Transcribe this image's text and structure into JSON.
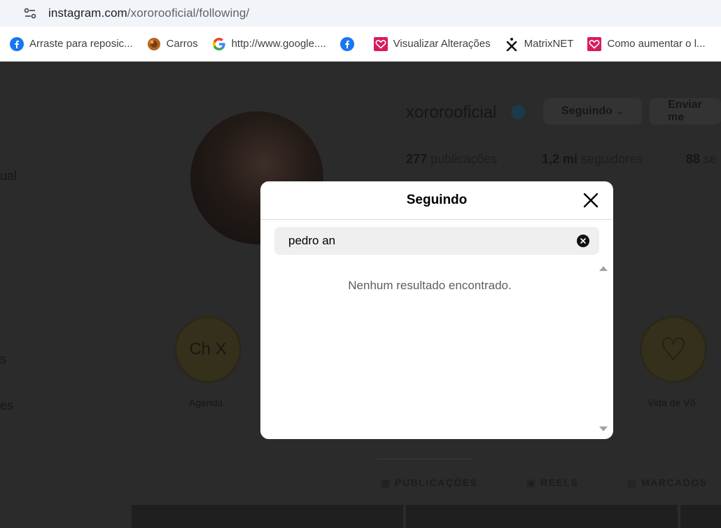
{
  "browser": {
    "url_host": "instagram.com",
    "url_path": "/xororooficial/following/",
    "bookmarks": [
      {
        "label": "Arraste para reposic...",
        "icon": "facebook-icon"
      },
      {
        "label": "Carros",
        "icon": "carros-favicon"
      },
      {
        "label": "http://www.google....",
        "icon": "google-icon"
      },
      {
        "label": "",
        "icon": "facebook-icon"
      },
      {
        "label": "Visualizar Alterações",
        "icon": "pink-heart-favicon"
      },
      {
        "label": "MatrixNET",
        "icon": "matrixnet-favicon"
      },
      {
        "label": "Como aumentar o l...",
        "icon": "pink-heart-favicon"
      }
    ]
  },
  "profile": {
    "username": "xororooficial",
    "following_button": "Seguindo",
    "message_button": "Enviar me",
    "stats": [
      {
        "value": "277",
        "label": "publicações"
      },
      {
        "value": "1,2 mi",
        "label": "seguidores"
      },
      {
        "value": "88",
        "label": "se"
      }
    ],
    "sidebar_fragments": [
      "ual",
      "s",
      "es"
    ],
    "highlights": [
      {
        "label": "Agenda",
        "text": "Ch X"
      },
      {
        "label": "Vida de Vô",
        "text": "♡"
      }
    ],
    "tabs": [
      "PUBLICAÇÕES",
      "REELS",
      "MARCADOS"
    ]
  },
  "modal": {
    "title": "Seguindo",
    "search_value": "pedro an",
    "empty_message": "Nenhum resultado encontrado."
  },
  "colors": {
    "overlay_bg": "#2b2b2b",
    "modal_bg": "#ffffff",
    "search_bg": "#efefef",
    "facebook_blue": "#1877f2",
    "pink_favicon": "#d81b60"
  }
}
